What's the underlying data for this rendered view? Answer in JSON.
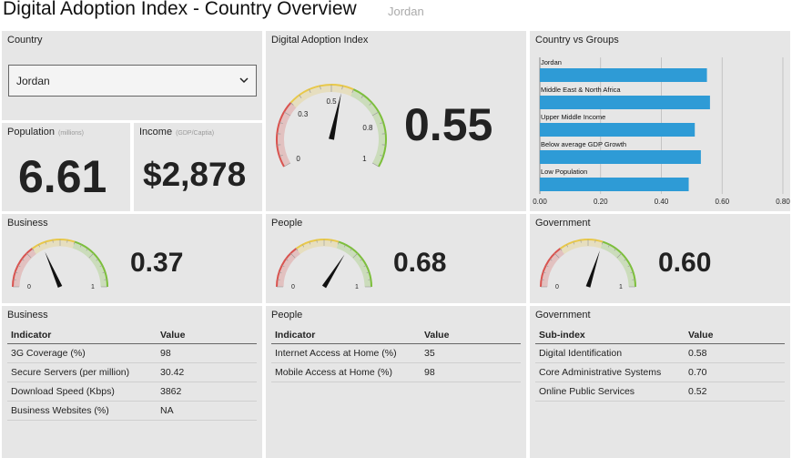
{
  "header": {
    "title": "Digital Adoption Index - Country Overview",
    "country": "Jordan"
  },
  "country_panel": {
    "label": "Country",
    "selected": "Jordan",
    "chevron_icon": "chevron-down-icon"
  },
  "population": {
    "label": "Population",
    "note": "(millions)",
    "value": "6.61"
  },
  "income": {
    "label": "Income",
    "note": "(GDP/Captia)",
    "value": "$2,878"
  },
  "dai": {
    "label": "Digital Adoption Index",
    "value_text": "0.55",
    "value": 0.55,
    "ticks": [
      "0",
      "0.3",
      "0.5",
      "0.8",
      "1"
    ]
  },
  "groups": {
    "label": "Country vs Groups",
    "chart_data": {
      "type": "bar",
      "orientation": "horizontal",
      "categories": [
        "Jordan",
        "Middle East & North Africa",
        "Upper Middle Income",
        "Below average GDP Growth",
        "Low Population"
      ],
      "values": [
        0.55,
        0.56,
        0.51,
        0.53,
        0.49
      ],
      "xlim": [
        0,
        0.8
      ],
      "x_ticks": [
        "0.00",
        "0.20",
        "0.40",
        "0.60",
        "0.80"
      ],
      "grid": true,
      "bar_color": "#2e9bd6"
    }
  },
  "business": {
    "label": "Business",
    "value_text": "0.37",
    "value": 0.37,
    "min_label": "0",
    "max_label": "1"
  },
  "people": {
    "label": "People",
    "value_text": "0.68",
    "value": 0.68,
    "min_label": "0",
    "max_label": "1"
  },
  "government": {
    "label": "Government",
    "value_text": "0.60",
    "value": 0.6,
    "min_label": "0",
    "max_label": "1"
  },
  "business_table": {
    "label": "Business",
    "headers": [
      "Indicator",
      "Value"
    ],
    "rows": [
      [
        "3G Coverage (%)",
        "98"
      ],
      [
        "Secure Servers (per million)",
        "30.42"
      ],
      [
        "Download Speed (Kbps)",
        "3862"
      ],
      [
        "Business Websites (%)",
        "NA"
      ]
    ]
  },
  "people_table": {
    "label": "People",
    "headers": [
      "Indicator",
      "Value"
    ],
    "rows": [
      [
        "Internet Access at Home (%)",
        "35"
      ],
      [
        "Mobile Access at Home (%)",
        "98"
      ]
    ]
  },
  "gov_table": {
    "label": "Government",
    "headers": [
      "Sub-index",
      "Value"
    ],
    "rows": [
      [
        "Digital Identification",
        "0.58"
      ],
      [
        "Core Administrative Systems",
        "0.70"
      ],
      [
        "Online Public Services",
        "0.52"
      ]
    ]
  },
  "colors": {
    "gauge_red": "#d9534f",
    "gauge_yellow": "#e8c84a",
    "gauge_green": "#7cbf3a",
    "needle": "#111111"
  }
}
